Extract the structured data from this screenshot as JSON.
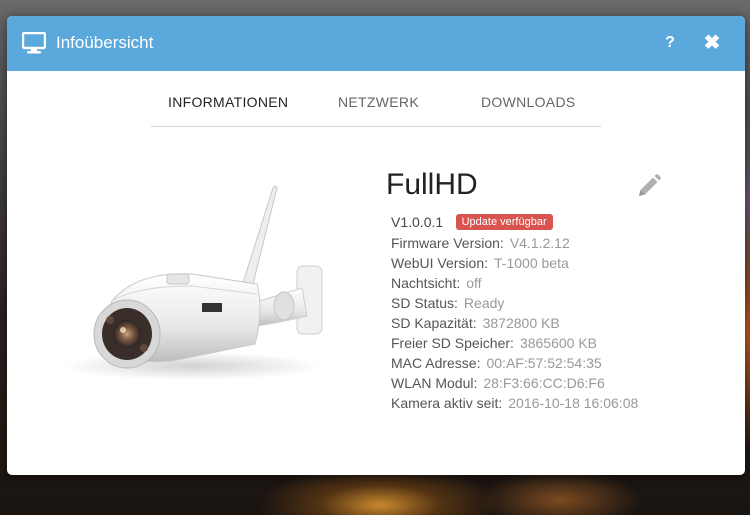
{
  "dialog": {
    "title": "Infoübersicht",
    "help_label": "?",
    "close_label": "✖"
  },
  "tabs": [
    {
      "label": "INFORMATIONEN",
      "active": true
    },
    {
      "label": "NETZWERK",
      "active": false
    },
    {
      "label": "DOWNLOADS",
      "active": false
    }
  ],
  "device": {
    "name": "FullHD",
    "version": "V1.0.0.1",
    "update_badge": "Update verfügbar"
  },
  "info": [
    {
      "label": "Firmware Version:",
      "value": "V4.1.2.12"
    },
    {
      "label": "WebUI Version:",
      "value": "T-1000 beta"
    },
    {
      "label": "Nachtsicht:",
      "value": "off"
    },
    {
      "label": "SD Status:",
      "value": "Ready"
    },
    {
      "label": "SD Kapazität:",
      "value": "3872800 KB"
    },
    {
      "label": "Freier SD Speicher:",
      "value": "3865600 KB"
    },
    {
      "label": "MAC Adresse:",
      "value": "00:AF:57:52:54:35"
    },
    {
      "label": "WLAN Modul:",
      "value": "28:F3:66:CC:D6:F6"
    },
    {
      "label": "Kamera aktiv seit:",
      "value": "2016-10-18 16:06:08"
    }
  ],
  "colors": {
    "titlebar": "#5ba9dc",
    "badge": "#d9534f"
  },
  "icons": {
    "title": "monitor-icon",
    "edit": "pencil-icon"
  }
}
